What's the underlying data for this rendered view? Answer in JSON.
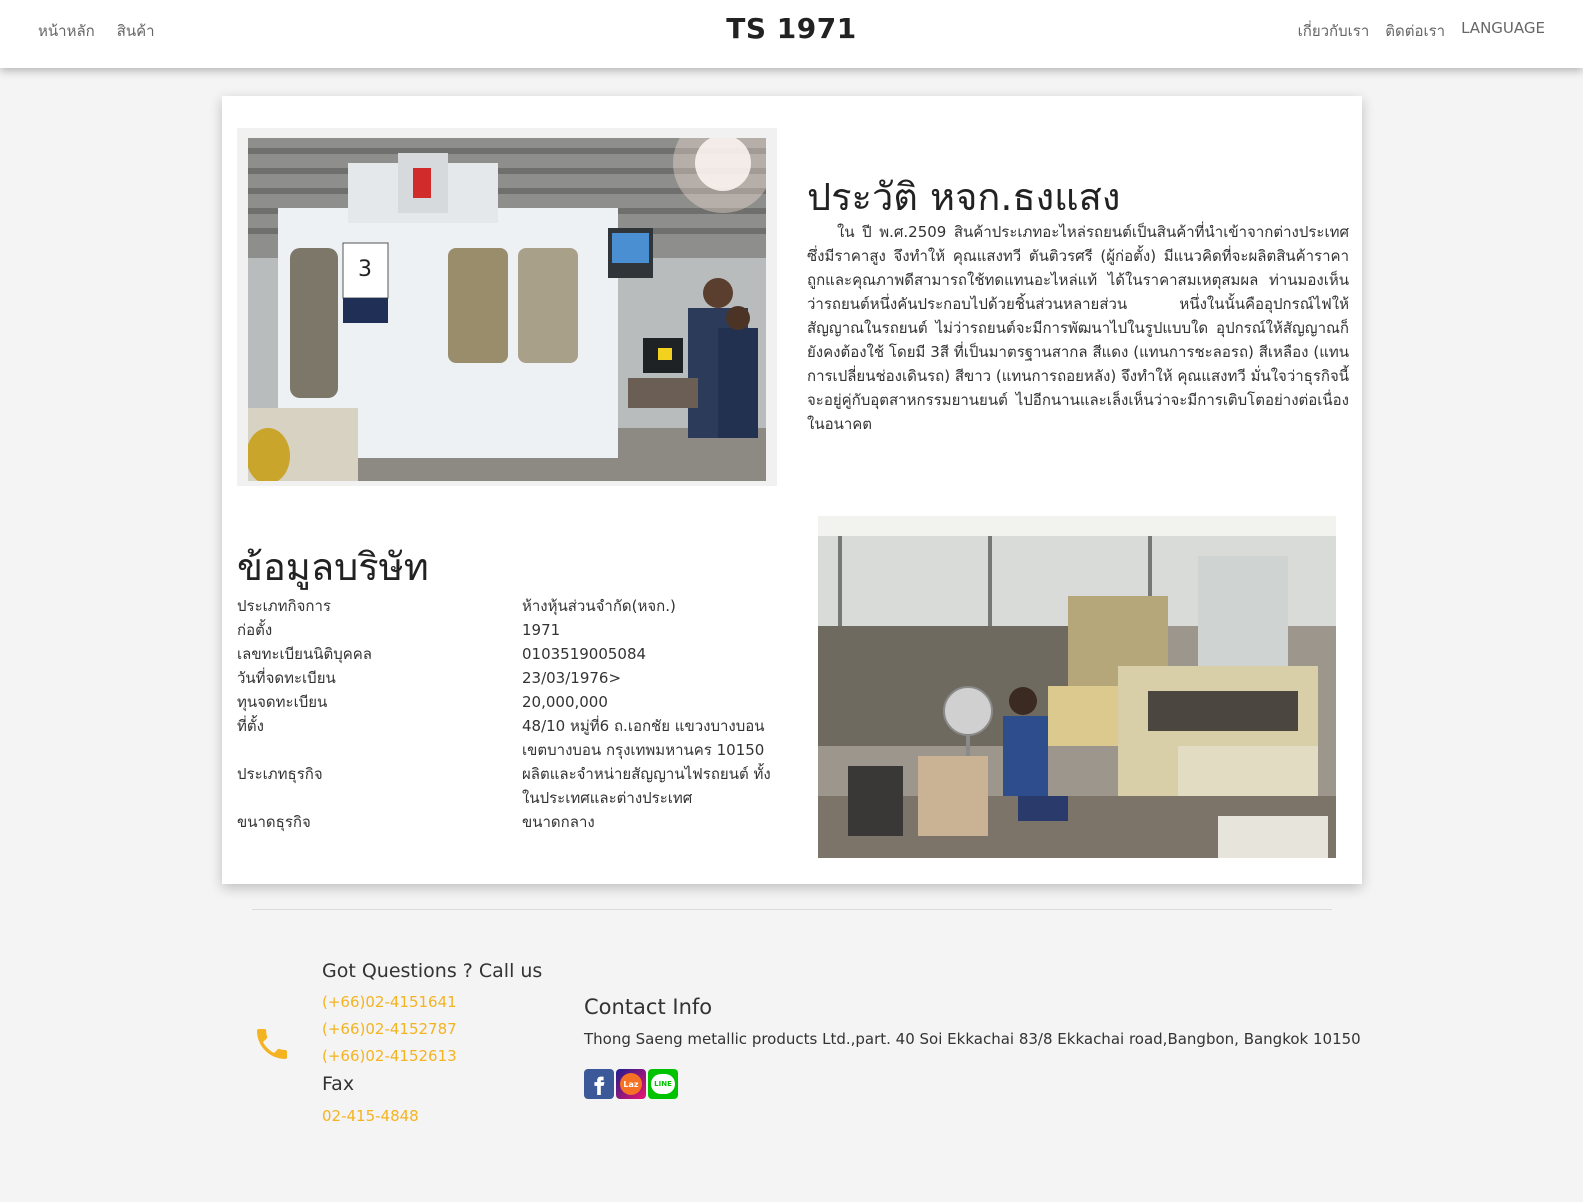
{
  "nav": {
    "left_links": [
      "หน้าหลัก",
      "สินค้า"
    ],
    "brand": "TS 1971",
    "right_links": [
      "เกี่ยวกับเรา",
      "ติดต่อเรา",
      "LANGUAGE"
    ]
  },
  "history": {
    "title": "ประวัติ หจก.ธงแสง",
    "body": "ใน ปี พ.ศ.2509 สินค้าประเภทอะไหล่รถยนต์เป็นสินค้าที่นำเข้าจากต่างประเทศซึ่งมีราคาสูง จึงทำให้ คุณแสงทวี ตันติวรศรี (ผู้ก่อตั้ง) มีแนวคิดที่จะผลิตสินค้าราคาถูกและคุณภาพดีสามารถใช้ทดแทนอะไหล่แท้ ได้ในราคาสมเหตุสมผล ท่านมองเห็นว่ารถยนต์หนึ่งคันประกอบไปด้วยชิ้นส่วนหลายส่วน หนึ่งในนั้นคืออุปกรณ์ไฟให้สัญญาณในรถยนต์ ไม่ว่ารถยนต์จะมีการพัฒนาไปในรูปแบบใด อุปกรณ์ให้สัญญาณก็ยังคงต้องใช้ โดยมี 3สี ที่เป็นมาตรฐานสากล สีแดง (แทนการชะลอรถ) สีเหลือง (แทนการเปลี่ยนช่องเดินรถ) สีขาว (แทนการถอยหลัง) จึงทำให้ คุณแสงทวี มั่นใจว่าธุรกิจนี้ จะอยู่คู่กับอุตสาหกรรมยานยนต์ ไปอีกนานและเล็งเห็นว่าจะมีการเติบโตอย่างต่อเนื่องในอนาคต"
  },
  "company_info": {
    "title": "ข้อมูลบริษัท",
    "rows": [
      {
        "label": "ประเภทกิจการ",
        "value": "ห้างหุ้นส่วนจำกัด(หจก.)"
      },
      {
        "label": "ก่อตั้ง",
        "value": "1971"
      },
      {
        "label": "เลขทะเบียนนิติบุคคล",
        "value": "0103519005084"
      },
      {
        "label": "วันที่จดทะเบียน",
        "value": "23/03/1976>"
      },
      {
        "label": "ทุนจดทะเบียน",
        "value": "20,000,000"
      },
      {
        "label": "ที่ตั้ง",
        "value": "48/10 หมู่ที่6 ถ.เอกชัย แขวงบางบอน เขตบางบอน กรุงเทพมหานคร 10150"
      },
      {
        "label": "ประเภทธุรกิจ",
        "value": "ผลิตและจำหน่ายสัญญานไฟรถยนต์ ทั้งในประเทศและต่างประเทศ"
      },
      {
        "label": "ขนาดธุรกิจ",
        "value": "ขนาดกลาง"
      }
    ]
  },
  "footer": {
    "questions_title": "Got Questions ? Call us",
    "phones": [
      "(+66)02-4151641",
      "(+66)02-4152787",
      "(+66)02-4152613"
    ],
    "fax_title": "Fax",
    "fax": "02-415-4848",
    "contact_title": "Contact Info",
    "address": "Thong Saeng metallic products Ltd.,part. 40 Soi Ekkachai 83/8 Ekkachai road,Bangbon, Bangkok 10150",
    "social": {
      "lazada_text": "Laz",
      "line_text": "LINE"
    }
  },
  "colors": {
    "accent": "#f4b321",
    "facebook": "#3b5998",
    "line": "#00c300"
  }
}
